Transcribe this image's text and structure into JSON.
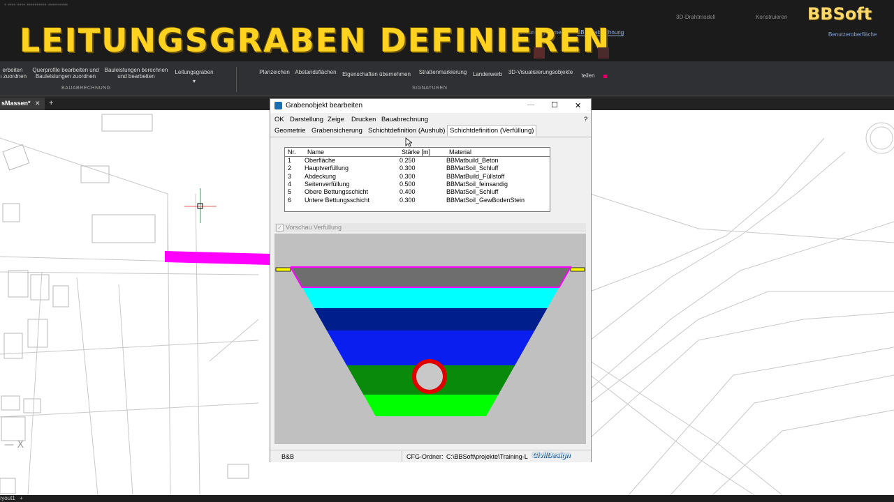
{
  "overlay": {
    "title": "LEITUNGSGRABEN DEFINIEREN",
    "brand": "BBSoft"
  },
  "ribbon": {
    "items": [
      "erbeiten\n ı zuordnen",
      "Querprofile bearbeiten und\nBauleistungen zuordnen",
      "Bauleistungen berechnen\nund bearbeiten",
      "Leitungsgraben",
      "Planzeichen",
      "Abstandsflächen",
      "Eigenschaften übernehmen",
      "Straßenmarkierung",
      "Landerwerb",
      "3D-Visualisierungsobjekte",
      "teilen"
    ],
    "groups": [
      "BAUABRECHNUNG",
      "SIGNATUREN"
    ],
    "top_tabs": [
      "3D-Drahtmodell",
      "Konstruieren",
      "BBLeitungssysteme",
      "BBBauabrechnung",
      "Benutzeroberfläche"
    ]
  },
  "doc_tab": {
    "label": "sMassen*",
    "close": "✕",
    "add": "+"
  },
  "status_bar": {
    "layout": "ıyout1",
    "add": "+"
  },
  "dialog": {
    "title": "Grabenobjekt  bearbeiten",
    "window_buttons": {
      "minimize": "—",
      "maximize": "☐",
      "close": "✕"
    },
    "menu": [
      "OK",
      "Darstellung",
      "Zeige",
      "Drucken",
      "Bauabrechnung"
    ],
    "help": "?",
    "tabs": [
      "Geometrie",
      "Grabensicherung",
      "Schichtdefinition (Aushub)",
      "Schichtdefinition (Verfüllung)"
    ],
    "active_tab": "Schichtdefinition (Verfüllung)",
    "table": {
      "headers": [
        "Nr.",
        "Name",
        "Stärke [m]",
        "Material"
      ],
      "rows": [
        [
          "1",
          "Oberfläche",
          "0.250",
          "BBMatbuild_Beton"
        ],
        [
          "2",
          "Hauptverfüllung",
          "0.300",
          "BBMatSoil_Schluff"
        ],
        [
          "3",
          "Abdeckung",
          "0.300",
          "BBMatBuild_Füllstoff"
        ],
        [
          "4",
          "Seitenverfüllung",
          "0.500",
          "BBMatSoil_feinsandig"
        ],
        [
          "5",
          "Obere Bettungsschicht",
          "0.400",
          "BBMatSoil_Schluff"
        ],
        [
          "6",
          "Untere Bettungsschicht",
          "0.300",
          "BBMatSoil_GewBodenStein"
        ]
      ]
    },
    "preview_checkbox": {
      "label": "Vorschau Verfüllung",
      "checked": true
    },
    "status": {
      "left": "B&B",
      "cfg_label": "CFG-Ordner:",
      "cfg_path": "C:\\BBSoft\\projekte\\Training-L",
      "logo": "CivilDesign"
    },
    "layer_colors": [
      "#6e6e6e",
      "#00ffff",
      "#001e8c",
      "#0a1ef0",
      "#0a8a0a",
      "#00ff00"
    ],
    "pipe_color": "#e00000",
    "trench_outline_color": "#ff00ff",
    "surface_color": "#ffff00"
  },
  "colors": {
    "title_yellow": "#ffd21f",
    "magenta_feature": "#ff00ff"
  }
}
